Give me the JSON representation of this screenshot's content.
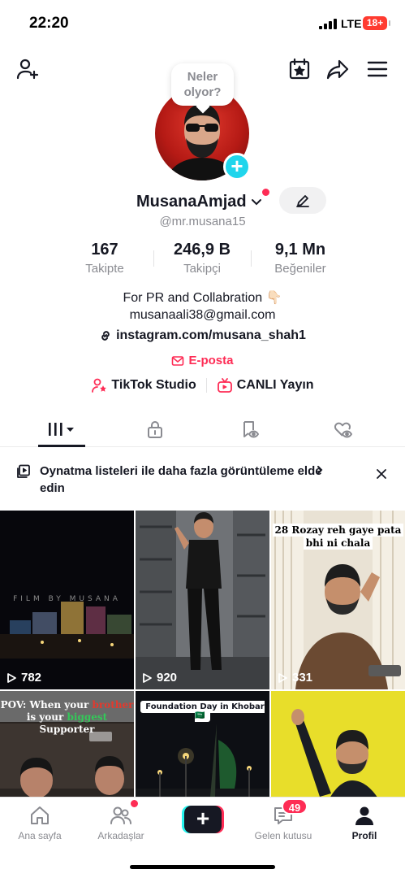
{
  "status_bar": {
    "time": "22:20",
    "network": "LTE",
    "battery": "18+"
  },
  "header": {
    "icons": [
      "add-user-icon",
      "calendar-star-icon",
      "share-icon",
      "menu-icon"
    ]
  },
  "profile": {
    "bubble_text": "Neler olyor?",
    "display_name": "MusanaAmjad",
    "username": "@mr.musana15",
    "stats": [
      {
        "value": "167",
        "label": "Takipte"
      },
      {
        "value": "246,9 B",
        "label": "Takipçi"
      },
      {
        "value": "9,1 Mn",
        "label": "Beğeniler"
      }
    ],
    "bio_line1": "For PR and Collabration 👇🏻",
    "bio_line2": "musanaali38@gmail.com",
    "link": "instagram.com/musana_shah1",
    "email_label": "E-posta",
    "tiktok_studio": "TikTok Studio",
    "live": "CANLI Yayın"
  },
  "tabs": [
    "videos",
    "private",
    "reposts",
    "liked"
  ],
  "banner": {
    "text": "Oynatma listeleri ile daha fazla görüntüleme elde edin"
  },
  "videos": [
    {
      "views": "782",
      "caption": "FILM BY MUSANA"
    },
    {
      "views": "920",
      "caption": ""
    },
    {
      "views": "331",
      "caption_line1": "28 Rozay reh gaye pata",
      "caption_line2": "bhi ni chala"
    },
    {
      "views": "",
      "caption_p1": "POV: When your ",
      "caption_p2": "brother",
      "caption_p3": "is your ",
      "caption_p4": "biggest",
      "caption_p5": " Supporter"
    },
    {
      "views": "",
      "caption": "Foundation Day in Khobar 🇸🇦"
    },
    {
      "views": "",
      "caption": ""
    }
  ],
  "bottom_nav": {
    "home": "Ana sayfa",
    "friends": "Arkadaşlar",
    "inbox": "Gelen kutusu",
    "inbox_badge": "49",
    "profile": "Profil"
  },
  "colors": {
    "accent": "#fe2c55",
    "cyan": "#25f4ee",
    "text": "#161823",
    "muted": "#8a8b91"
  }
}
